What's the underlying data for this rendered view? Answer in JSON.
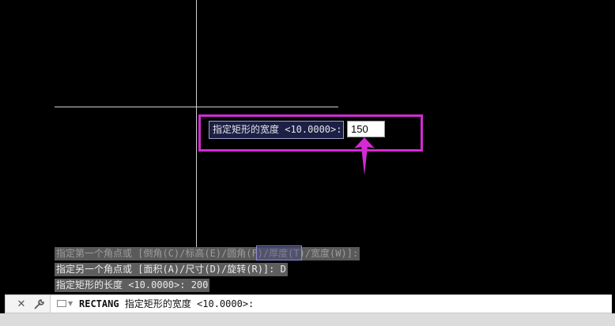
{
  "dynamic_input": {
    "prompt": "指定矩形的宽度 <10.0000>:",
    "value": "150"
  },
  "history": [
    "指定第一个角点或 [倒角(C)/标高(E)/圆角(F)/厚度(T)/宽度(W)]:",
    "指定另一个角点或 [面积(A)/尺寸(D)/旋转(R)]: D",
    "指定矩形的长度 <10.0000>: 200"
  ],
  "command_line": {
    "command": "RECTANG",
    "prompt": "指定矩形的宽度 <10.0000>:"
  },
  "icons": {
    "close": "close-icon",
    "customize": "wrench-icon",
    "command": "rectangle-icon",
    "dropdown": "chevron-down-icon",
    "annotation": "arrow-up-icon"
  },
  "colors": {
    "canvas": "#000000",
    "highlight": "#d42ad4",
    "prompt_background": "#1c1f46"
  }
}
